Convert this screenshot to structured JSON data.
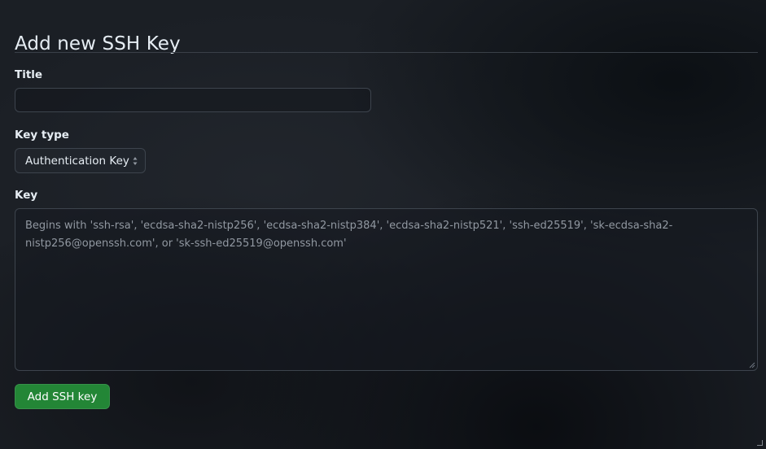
{
  "heading": "Add new SSH Key",
  "title_field": {
    "label": "Title",
    "value": "",
    "placeholder": ""
  },
  "key_type": {
    "label": "Key type",
    "selected": "Authentication Key"
  },
  "key_field": {
    "label": "Key",
    "placeholder": "Begins with 'ssh-rsa', 'ecdsa-sha2-nistp256', 'ecdsa-sha2-nistp384', 'ecdsa-sha2-nistp521', 'ssh-ed25519', 'sk-ecdsa-sha2-nistp256@openssh.com', or 'sk-ssh-ed25519@openssh.com'"
  },
  "submit_label": "Add SSH key",
  "colors": {
    "primary_button": "#238636",
    "background": "#1b1f25",
    "border": "#3d444d",
    "text": "#e6edf3",
    "muted_text": "#9198a1"
  },
  "icons": {
    "select_arrows": "sort-arrows-icon",
    "resize": "resize-grip-icon"
  }
}
